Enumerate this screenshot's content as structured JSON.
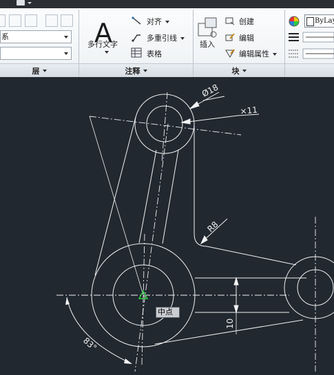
{
  "ribbon": {
    "layers_combo_text": "系",
    "layers_panel_label": "层",
    "annotation": {
      "multiline_text_label": "多行文字",
      "align_label": "对齐",
      "multileader_label": "多重引线",
      "table_label": "表格",
      "panel_label": "注释"
    },
    "block": {
      "insert_label": "插入",
      "create_label": "创建",
      "edit_label": "编辑",
      "edit_attributes_label": "编辑属性",
      "panel_label": "块"
    },
    "properties": {
      "color_value": "ByLayer"
    }
  },
  "drawing": {
    "dimension_diameter_18": "Ø18",
    "dimension_diameter_11": "×11",
    "dimension_radius": "R8",
    "dimension_linear": "10",
    "dimension_angle": "83°",
    "snap_tooltip": "中点"
  },
  "colors": {
    "canvas_background": "#212830",
    "geometry_line": "#f2f2f2",
    "snap_marker": "#2ecc40"
  }
}
